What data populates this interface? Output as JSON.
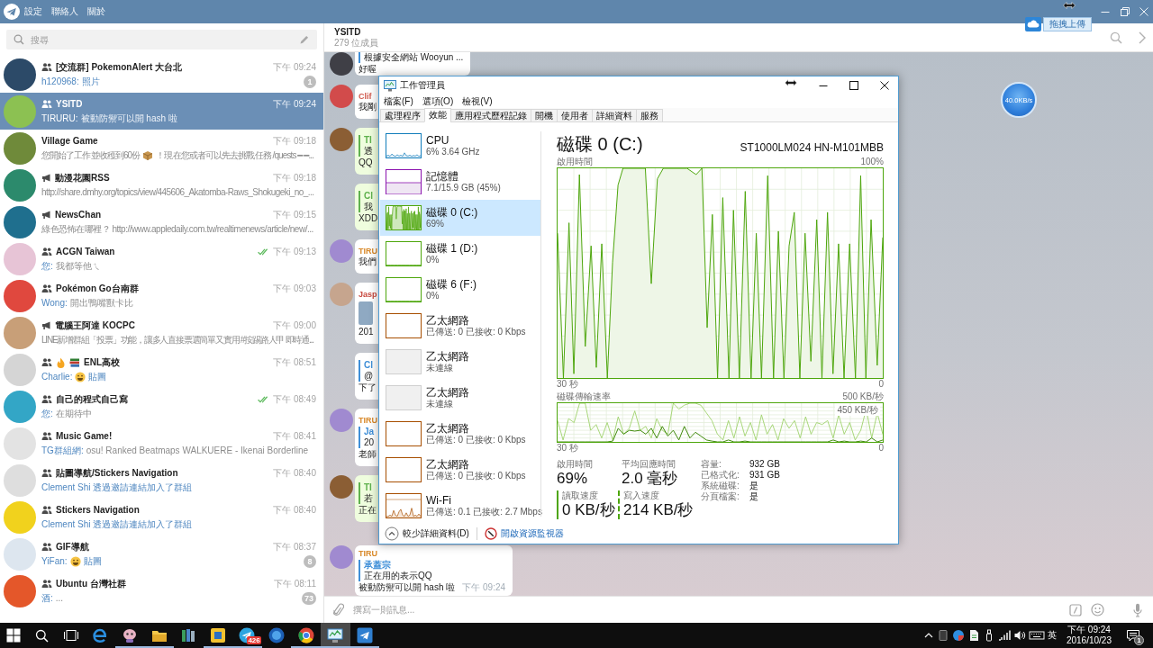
{
  "app_bar": {
    "menu": [
      "設定",
      "聯絡人",
      "關於"
    ]
  },
  "search": {
    "placeholder": "搜尋"
  },
  "chats": [
    {
      "kind": "group",
      "name": "[交流群] PokemonAlert 大台北",
      "time": "下午 09:24",
      "read": false,
      "selected": false,
      "unread": "1",
      "preview": [
        {
          "kind": "sender",
          "text": "h120968:"
        },
        {
          "kind": "media",
          "text": "照片"
        }
      ]
    },
    {
      "kind": "group",
      "name": "YSITD",
      "time": "下午 09:24",
      "read": false,
      "selected": true,
      "preview": [
        {
          "kind": "sender",
          "text": "TIRURU:"
        },
        {
          "kind": "text",
          "text": "被動防禦可以開 hash 啦"
        }
      ]
    },
    {
      "kind": "private",
      "name": "Village Game",
      "time": "下午 09:18",
      "read": false,
      "selected": false,
      "preview": [
        {
          "kind": "text",
          "text": "您開始了工作並收穫到60份"
        },
        {
          "kind": "package"
        },
        {
          "kind": "text",
          "text": "！現在您或者可以先去挑戰任務 /quests ━ ━..."
        }
      ]
    },
    {
      "kind": "channel",
      "name": "動漫花園RSS",
      "time": "下午 09:18",
      "read": false,
      "selected": false,
      "preview": [
        {
          "kind": "text",
          "text": "http://share.dmhy.org/topics/view/445606_Akatomba-Raws_Shokugeki_no_..."
        }
      ]
    },
    {
      "kind": "channel",
      "name": "NewsChan",
      "time": "下午 09:15",
      "read": false,
      "selected": false,
      "preview": [
        {
          "kind": "text",
          "text": "綠色恐怖在哪裡？ http://www.appledaily.com.tw/realtimenews/article/new/..."
        }
      ]
    },
    {
      "kind": "group",
      "name": "ACGN Taiwan",
      "time": "下午 09:13",
      "read": true,
      "selected": false,
      "preview": [
        {
          "kind": "sender",
          "text": "您:"
        },
        {
          "kind": "text",
          "text": "我都等他ㄟ"
        }
      ]
    },
    {
      "kind": "group",
      "name": "Pokémon Go台南群",
      "time": "下午 09:03",
      "read": false,
      "selected": false,
      "preview": [
        {
          "kind": "sender",
          "text": "Wong:"
        },
        {
          "kind": "text",
          "text": "開出鴨嘴獸卡比"
        }
      ]
    },
    {
      "kind": "channel",
      "name": "電腦王阿達 KOCPC",
      "time": "下午 09:00",
      "read": false,
      "selected": false,
      "preview": [
        {
          "kind": "text",
          "text": "LINE新增群組「投票」功能，讓多人直接票選簡單又實用 #按踢路人甲 即時通..."
        }
      ]
    },
    {
      "kind": "group",
      "name": "ENL高校",
      "name_emoji": [
        {
          "kind": "flame"
        },
        {
          "kind": "books"
        }
      ],
      "time": "下午 08:51",
      "read": false,
      "selected": false,
      "preview": [
        {
          "kind": "sender",
          "text": "Charlie:"
        },
        {
          "kind": "grin"
        },
        {
          "kind": "media",
          "text": "貼圖"
        }
      ]
    },
    {
      "kind": "group",
      "name": "自己的程式自己寫",
      "time": "下午 08:49",
      "read": true,
      "selected": false,
      "preview": [
        {
          "kind": "sender",
          "text": "您:"
        },
        {
          "kind": "text",
          "text": "在期待中"
        }
      ]
    },
    {
      "kind": "group",
      "name": "Music Game!",
      "time": "下午 08:41",
      "read": false,
      "selected": false,
      "preview": [
        {
          "kind": "sender",
          "text": "TG群組網:"
        },
        {
          "kind": "text",
          "text": "osu! Ranked Beatmaps WALKUERE - Ikenai Borderline"
        }
      ]
    },
    {
      "kind": "group",
      "name": "貼圖導航/Stickers Navigation",
      "time": "下午 08:40",
      "read": false,
      "selected": false,
      "preview": [
        {
          "kind": "media",
          "text": "Clement Shi 透過邀請連結加入了群組"
        }
      ]
    },
    {
      "kind": "group",
      "name": "Stickers Navigation",
      "time": "下午 08:40",
      "read": false,
      "selected": false,
      "preview": [
        {
          "kind": "media",
          "text": "Clement Shi 透過邀請連結加入了群組"
        }
      ]
    },
    {
      "kind": "group",
      "name": "GIF導航",
      "time": "下午 08:37",
      "read": false,
      "selected": false,
      "unread": "8",
      "preview": [
        {
          "kind": "sender",
          "text": "YiFan:"
        },
        {
          "kind": "grin"
        },
        {
          "kind": "media",
          "text": "貼圖"
        }
      ]
    },
    {
      "kind": "group",
      "name": "Ubuntu 台灣社群",
      "time": "下午 08:11",
      "read": false,
      "selected": false,
      "unread": "73",
      "preview": [
        {
          "kind": "sender",
          "text": "酒:"
        },
        {
          "kind": "text",
          "text": "..."
        }
      ]
    }
  ],
  "chat_header": {
    "title": "YSITD",
    "subtitle": "279 位成員"
  },
  "messages": [
    {
      "own": false,
      "show_avatar": true,
      "image": false,
      "quote": {
        "text": "根據安全網站 Wooyun ..."
      },
      "text": "好喔"
    },
    {
      "own": false,
      "show_avatar": true,
      "image": false,
      "sender": "Clif",
      "color": "#d0574b",
      "text": "我剛"
    },
    {
      "own": true,
      "show_avatar": true,
      "image": false,
      "quote": {
        "name": "TI",
        "text": "透"
      },
      "text": "QQ"
    },
    {
      "own": true,
      "show_avatar": false,
      "image": false,
      "quote": {
        "name": "Cl",
        "text": "我"
      },
      "text": "XDD"
    },
    {
      "own": false,
      "show_avatar": true,
      "image": false,
      "sender": "TIRU",
      "color": "#d98a2b",
      "text": "我們"
    },
    {
      "own": false,
      "show_avatar": true,
      "image": true,
      "sender": "Jasp",
      "color": "#c8493f",
      "text": "201"
    },
    {
      "own": false,
      "show_avatar": false,
      "image": false,
      "quote": {
        "name": "Cl",
        "text": "@"
      },
      "text": "下了"
    },
    {
      "own": false,
      "show_avatar": true,
      "image": false,
      "sender": "TIRU",
      "color": "#d98a2b",
      "quote": {
        "name": "Ja",
        "text": "20"
      },
      "text": "老師"
    },
    {
      "own": true,
      "show_avatar": true,
      "image": false,
      "quote": {
        "name": "TI",
        "text": "若"
      },
      "text": "正在"
    },
    {
      "own": false,
      "show_avatar": true,
      "image": false,
      "sender": "TIRU",
      "color": "#d98a2b",
      "quote": {
        "name": "承蓋宗",
        "text": "正在用的表示QQ"
      },
      "text": "被動防禦可以開 hash 啦",
      "time": "下午 09:24"
    }
  ],
  "composer": {
    "placeholder": "撰寫一則訊息..."
  },
  "upload_widget": {
    "label": "拖拽上傳"
  },
  "speed_ball": {
    "reading": "40.0KB/s"
  },
  "task_manager": {
    "title": "工作管理員",
    "menu": [
      "檔案(F)",
      "選項(O)",
      "檢視(V)"
    ],
    "tabs": [
      {
        "label": "處理程序",
        "selected": false
      },
      {
        "label": "效能",
        "selected": true
      },
      {
        "label": "應用程式歷程記錄",
        "selected": false
      },
      {
        "label": "開機",
        "selected": false
      },
      {
        "label": "使用者",
        "selected": false
      },
      {
        "label": "詳細資料",
        "selected": false
      },
      {
        "label": "服務",
        "selected": false
      }
    ],
    "resources": [
      {
        "kind": "cpu",
        "name": "CPU",
        "detail": "6% 3.64 GHz",
        "selected": false,
        "connected": true
      },
      {
        "kind": "memory",
        "name": "記憶體",
        "detail": "7.1/15.9 GB (45%)",
        "selected": false,
        "connected": true
      },
      {
        "kind": "disk",
        "name": "磁碟 0 (C:)",
        "detail": "69%",
        "selected": true,
        "connected": true
      },
      {
        "kind": "disk",
        "name": "磁碟 1 (D:)",
        "detail": "0%",
        "selected": false,
        "connected": true
      },
      {
        "kind": "disk",
        "name": "磁碟 6 (F:)",
        "detail": "0%",
        "selected": false,
        "connected": true
      },
      {
        "kind": "ethernet",
        "name": "乙太網路",
        "detail": "已傳送: 0 已接收: 0 Kbps",
        "selected": false,
        "connected": true
      },
      {
        "kind": "ethernet",
        "name": "乙太網路",
        "detail": "未連線",
        "selected": false,
        "connected": false
      },
      {
        "kind": "ethernet",
        "name": "乙太網路",
        "detail": "未連線",
        "selected": false,
        "connected": false
      },
      {
        "kind": "ethernet",
        "name": "乙太網路",
        "detail": "已傳送: 0 已接收: 0 Kbps",
        "selected": false,
        "connected": true
      },
      {
        "kind": "ethernet",
        "name": "乙太網路",
        "detail": "已傳送: 0 已接收: 0 Kbps",
        "selected": false,
        "connected": true
      },
      {
        "kind": "wifi",
        "name": "Wi-Fi",
        "detail": "已傳送: 0.1 已接收: 2.7 Mbps",
        "selected": false,
        "connected": true
      }
    ],
    "detail": {
      "title": "磁碟 0 (C:)",
      "model": "ST1000LM024 HN-M101MBB",
      "activity_chart": {
        "label": "啟用時間",
        "max": "100%",
        "start": "30 秒",
        "end": "0"
      },
      "transfer_chart": {
        "label": "磁碟傳輸速率",
        "max": "500 KB/秒",
        "marker": "450 KB/秒",
        "start": "30 秒",
        "end": "0"
      },
      "stats": [
        {
          "label": "啟用時間",
          "value": "69%"
        },
        {
          "label": "平均回應時間",
          "value": "2.0 毫秒"
        }
      ],
      "speeds": [
        {
          "kind": "read",
          "label": "讀取速度",
          "value": "0 KB/秒"
        },
        {
          "kind": "write",
          "label": "寫入速度",
          "value": "214 KB/秒"
        }
      ],
      "properties": [
        {
          "label": "容量:",
          "value": "932 GB"
        },
        {
          "label": "已格式化:",
          "value": "931 GB"
        },
        {
          "label": "系統磁碟:",
          "value": "是"
        },
        {
          "label": "分頁檔案:",
          "value": "是"
        }
      ]
    },
    "footer": {
      "fewer_details": "較少詳細資料(D)",
      "resource_monitor": "開啟資源監視器"
    }
  },
  "taskbar": {
    "apps": [
      {
        "kind": "letter",
        "running": false,
        "active": false
      },
      {
        "kind": "mascot",
        "running": true,
        "active": false
      },
      {
        "kind": "folder",
        "running": true,
        "active": false
      },
      {
        "kind": "books",
        "running": false,
        "active": false
      },
      {
        "kind": "tile",
        "running": true,
        "active": false
      },
      {
        "kind": "plane",
        "running": true,
        "active": false,
        "badge": "426"
      },
      {
        "kind": "orb",
        "running": false,
        "active": false
      },
      {
        "kind": "ring",
        "running": true,
        "active": false
      },
      {
        "kind": "monitor",
        "running": true,
        "active": true
      },
      {
        "kind": "chat",
        "running": true,
        "active": false
      }
    ],
    "ime": "英",
    "time": "下午 09:24",
    "date": "2016/10/23",
    "notification_count": "1"
  }
}
